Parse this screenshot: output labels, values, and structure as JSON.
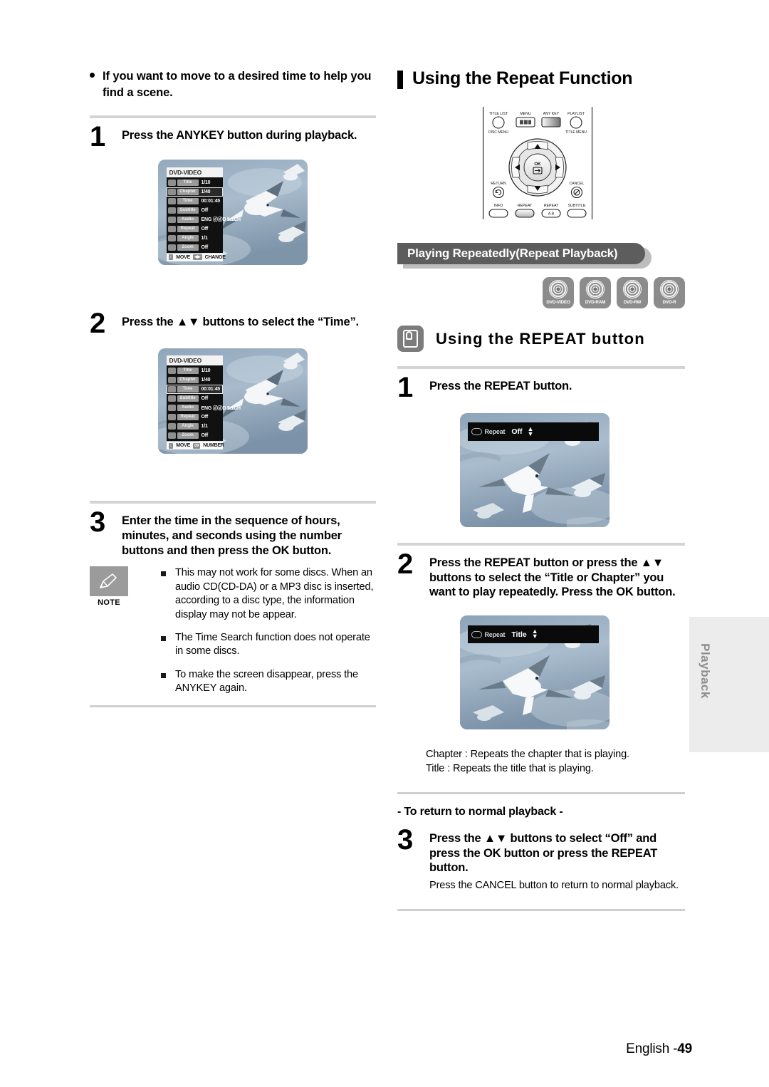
{
  "left_column": {
    "intro_bullet": "If you want to move to a desired time to help you find a scene.",
    "steps": [
      {
        "num": "1",
        "text": "Press the ANYKEY button during playback."
      },
      {
        "num": "2",
        "text": "Press the ▲▼ buttons to select the “Time”."
      },
      {
        "num": "3",
        "text": "Enter the time in the sequence of hours, minutes, and seconds using the number buttons and then press the OK button."
      }
    ],
    "osd_screen_1": {
      "title": "DVD-VIDEO",
      "selected": "Chapter",
      "rows": [
        {
          "label": "Title",
          "value": "1/10"
        },
        {
          "label": "Chapter",
          "value": "1/40"
        },
        {
          "label": "Time",
          "value": "00:01:45"
        },
        {
          "label": "Subtitle",
          "value": "Off"
        },
        {
          "label": "Audio",
          "value": "ENG ⓓⓓD 5.1CH"
        },
        {
          "label": "Repeat",
          "value": "Off"
        },
        {
          "label": "Angle",
          "value": "1/1"
        },
        {
          "label": "Zoom",
          "value": "Off"
        }
      ],
      "footer": [
        {
          "key": "↕",
          "text": "MOVE"
        },
        {
          "key": "◀▶",
          "text": "CHANGE"
        }
      ]
    },
    "osd_screen_2": {
      "title": "DVD-VIDEO",
      "selected": "Time",
      "rows": [
        {
          "label": "Title",
          "value": "1/10"
        },
        {
          "label": "Chapter",
          "value": "1/40"
        },
        {
          "label": "Time",
          "value": "00:01:45"
        },
        {
          "label": "Subtitle",
          "value": "Off"
        },
        {
          "label": "Audio",
          "value": "ENG ⓓⓓD 5.1CH"
        },
        {
          "label": "Repeat",
          "value": "Off"
        },
        {
          "label": "Angle",
          "value": "1/1"
        },
        {
          "label": "Zoom",
          "value": "Off"
        }
      ],
      "footer": [
        {
          "key": "↕",
          "text": "MOVE"
        },
        {
          "key": "09",
          "text": "NUMBER"
        }
      ]
    },
    "note": {
      "label": "NOTE",
      "items": [
        "This may not work for some discs. When an audio CD(CD-DA) or a MP3 disc is inserted, according to a disc type, the information display may not be appear.",
        "The Time Search function does not operate in some discs.",
        "To make the screen disappear, press the ANYKEY again."
      ]
    }
  },
  "right_column": {
    "section_title": "Using the Repeat Function",
    "remote": {
      "top_buttons": [
        {
          "top": "TITLE LIST",
          "bottom": "DISC MENU"
        },
        {
          "top": "MENU",
          "bottom": ""
        },
        {
          "top": "ANY KEY",
          "bottom": ""
        },
        {
          "top": "PLAYLIST",
          "bottom": "TITLE MENU"
        }
      ],
      "center_label": "OK",
      "left_mid": "RETURN",
      "right_mid": "CANCEL",
      "bottom_buttons": [
        "INFO",
        "REPEAT",
        "REPEAT",
        "SUBTITLE"
      ],
      "repeat_ab_label": "A-B"
    },
    "banner": "Playing Repeatedly(Repeat Playback)",
    "discs": [
      "DVD-VIDEO",
      "DVD-RAM",
      "DVD-RW",
      "DVD-R"
    ],
    "sub_section_title": "Using the REPEAT button",
    "steps": [
      {
        "num": "1",
        "text": "Press the REPEAT button."
      },
      {
        "num": "2",
        "text": "Press the REPEAT button or press the ▲▼ buttons to select the “Title or Chapter” you want to play repeatedly. Press the OK button."
      },
      {
        "num": "3",
        "text": "Press the ▲▼ buttons to select “Off” and press the OK button or press the REPEAT button."
      }
    ],
    "repeat_screen_1": {
      "label": "Repeat",
      "value": "Off"
    },
    "repeat_screen_2": {
      "label": "Repeat",
      "value": "Title"
    },
    "definitions": [
      "Chapter : Repeats the chapter that is playing.",
      "Title : Repeats the title that is playing."
    ],
    "return_heading": "- To return to normal playback -",
    "step3_note": "Press the CANCEL button to return to normal playback."
  },
  "side_tab": {
    "label": "Playback"
  },
  "footer": {
    "language": "English -",
    "page": "49"
  },
  "colors": {
    "banner_bg": "#5d5d5d",
    "banner_shadow": "#bdbdbd",
    "rule": "#d4d4d4",
    "side_tab_bg": "#ececec",
    "disc_bg": "#8c8c8c",
    "note_badge_bg": "#9b9b9b"
  }
}
